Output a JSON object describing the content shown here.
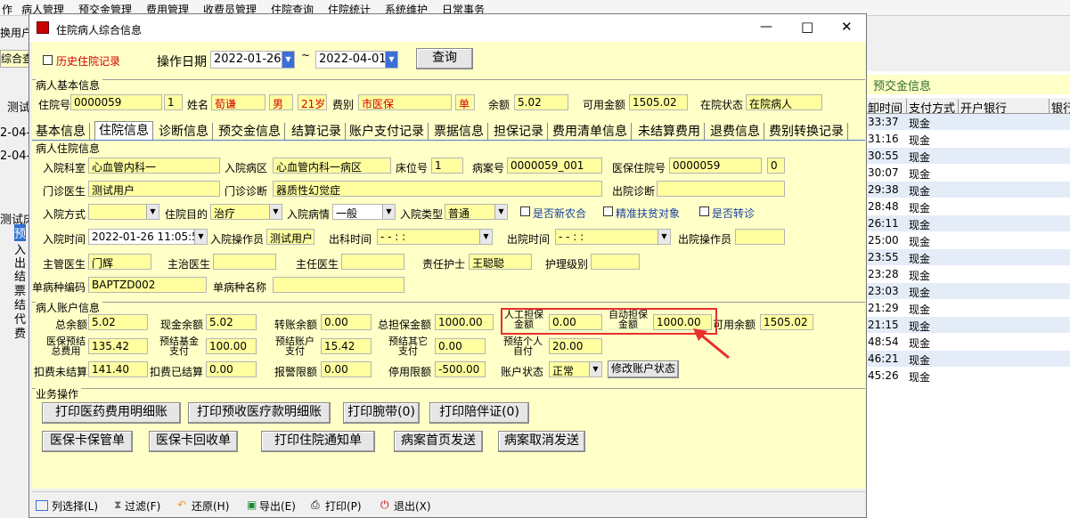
{
  "menubar": [
    "作",
    "病人管理",
    "预交金管理",
    "费用管理",
    "收费员管理",
    "住院查询",
    "住院统计",
    "系统维护",
    "日常事务"
  ],
  "bg": {
    "tool_label": "换用户",
    "tab_label": "综合查",
    "left_frag": [
      "测试",
      "2-04-",
      "2-04-",
      "测试床",
      "预",
      "入",
      "出",
      "结",
      "票",
      "结",
      "代",
      "费"
    ]
  },
  "right_panel": {
    "title": "预交金信息",
    "headers": [
      "卸时间",
      "支付方式",
      "开户银行",
      "银行"
    ],
    "rows": [
      [
        "33:37",
        "现金"
      ],
      [
        "31:16",
        "现金"
      ],
      [
        "30:55",
        "现金"
      ],
      [
        "30:07",
        "现金"
      ],
      [
        "29:38",
        "现金"
      ],
      [
        "28:48",
        "现金"
      ],
      [
        "26:11",
        "现金"
      ],
      [
        "25:00",
        "现金"
      ],
      [
        "23:55",
        "现金"
      ],
      [
        "23:28",
        "现金"
      ],
      [
        "23:03",
        "现金"
      ],
      [
        "21:29",
        "现金"
      ],
      [
        "21:15",
        "现金"
      ],
      [
        "48:54",
        "现金"
      ],
      [
        "46:21",
        "现金"
      ],
      [
        "45:26",
        "现金"
      ]
    ]
  },
  "window": {
    "title": "住院病人综合信息",
    "controls": {
      "minimize": "—",
      "maximize": "□",
      "close": "✕"
    },
    "history_label": "历史住院记录",
    "date_label": "操作日期",
    "date_from": "2022-01-26",
    "date_to": "2022-04-01",
    "tilde": "~",
    "query_btn": "查询",
    "basic": {
      "title": "病人基本信息",
      "zyh_label": "住院号",
      "zyh": "0000059",
      "zyh2": "1",
      "name_label": "姓名",
      "name": "荀谦",
      "sex": "男",
      "age": "21岁",
      "fb_label": "费别",
      "fb": "市医保",
      "dan": "单",
      "ye_label": "余额",
      "ye": "5.02",
      "kyje_label": "可用金额",
      "kyje": "1505.02",
      "zt_label": "在院状态",
      "zt": "在院病人"
    },
    "tabs": [
      "基本信息",
      "住院信息",
      "诊断信息",
      "预交金信息",
      "结算记录",
      "账户支付记录",
      "票据信息",
      "担保记录",
      "费用清单信息",
      "未结算费用",
      "退费信息",
      "费别转换记录"
    ],
    "zy": {
      "title": "病人住院信息",
      "ryks_label": "入院科室",
      "ryks": "心血管内科一",
      "rybq_label": "入院病区",
      "rybq": "心血管内科一病区",
      "cwh_label": "床位号",
      "cwh": "1",
      "bah_label": "病案号",
      "bah": "0000059_001",
      "ybzyh_label": "医保住院号",
      "ybzyh": "0000059",
      "ybzyh2": "0",
      "mzys_label": "门诊医生",
      "mzys": "测试用户",
      "mzzd_label": "门诊诊断",
      "mzzd": "器质性幻觉症",
      "cyzd_label": "出院诊断",
      "ryfs_label": "入院方式",
      "rymd_label": "住院目的",
      "rymd": "治疗",
      "rybq2_label": "入院病情",
      "rybq2": "一般",
      "rylx_label": "入院类型",
      "rylx": "普通",
      "xnh": "是否新农合",
      "fp": "精准扶贫对象",
      "zz": "是否转诊",
      "rysj_label": "入院时间",
      "rysj": "2022-01-26 11:05:56",
      "ryczy_label": "入院操作员",
      "ryczy": "测试用户",
      "cksj_label": "出科时间",
      "cksj": "-   -      :   :",
      "cysj_label": "出院时间",
      "cysj": "-   -      :   :",
      "cyczy_label": "出院操作员",
      "zgys_label": "主管医生",
      "zgys": "门辉",
      "zzys_label": "主治医生",
      "zrys_label": "主任医生",
      "zrhs_label": "责任护士",
      "zrhs": "王聪聪",
      "hljb_label": "护理级别",
      "dbz_bm_label": "单病种编码",
      "dbz_bm": "BAPTZD002",
      "dbz_mc_label": "单病种名称"
    },
    "acct": {
      "title": "病人账户信息",
      "zye_label": "总余额",
      "zye": "5.02",
      "xjye_label": "现金余额",
      "xjye": "5.02",
      "zzye_label": "转账余额",
      "zzye": "0.00",
      "zdbje_label": "总担保金额",
      "zdbje": "1000.00",
      "rgdb_label": "人工担保金额",
      "rgdb": "0.00",
      "zddb_label": "自动担保金额",
      "zddb": "1000.00",
      "kyye_label": "可用余额",
      "kyye": "1505.02",
      "ybzfy_label": "医保预结总费用",
      "ybzfy": "135.42",
      "yjjj_label": "预结基金支付",
      "yjjj": "100.00",
      "yjzh_label": "预结账户支付",
      "yjzh": "15.42",
      "yjqt_label": "预结其它支付",
      "yjqt": "0.00",
      "yjgr_label": "预结个人自付",
      "yjgr": "20.00",
      "kfwj_label": "扣费未结算",
      "kfwj": "141.40",
      "kfyj_label": "扣费已结算",
      "kfyj": "0.00",
      "bjxe_label": "报警限额",
      "bjxe": "0.00",
      "tyxe_label": "停用限额",
      "tyxe": "-500.00",
      "zhzt_label": "账户状态",
      "zhzt": "正常",
      "xgzt_btn": "修改账户状态"
    },
    "ops": {
      "title": "业务操作",
      "buttons": [
        "打印医药费用明细账",
        "打印预收医疗款明细账",
        "打印腕带(0)",
        "打印陪伴证(0)",
        "医保卡保管单",
        "医保卡回收单",
        "打印住院通知单",
        "病案首页发送",
        "病案取消发送"
      ]
    },
    "status": [
      "列选择(L)",
      "过滤(F)",
      "还原(H)",
      "导出(E)",
      "打印(P)",
      "退出(X)"
    ]
  }
}
